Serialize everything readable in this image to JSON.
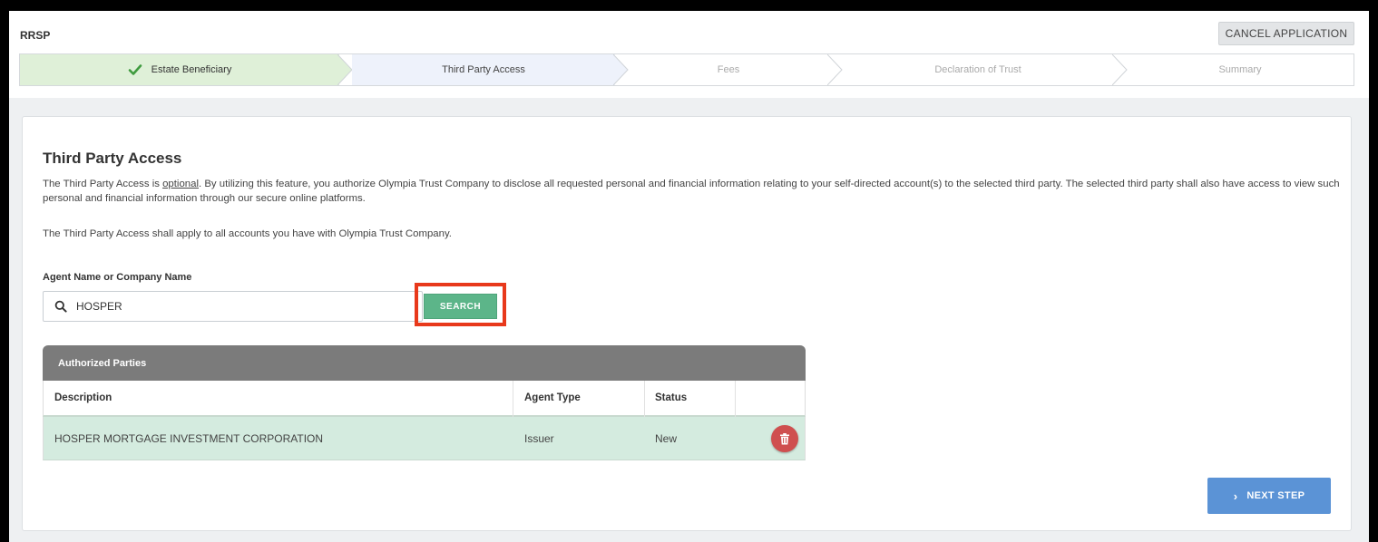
{
  "header": {
    "app_title": "RRSP",
    "cancel_label": "CANCEL APPLICATION"
  },
  "steps": [
    {
      "label": "Estate Beneficiary",
      "state": "done"
    },
    {
      "label": "Third Party Access",
      "state": "active"
    },
    {
      "label": "Fees",
      "state": "future"
    },
    {
      "label": "Declaration of Trust",
      "state": "future"
    },
    {
      "label": "Summary",
      "state": "future"
    }
  ],
  "section": {
    "title": "Third Party Access",
    "intro_pre": "The Third Party Access is ",
    "intro_link": "optional",
    "intro_post": ". By utilizing this feature, you authorize Olympia Trust Company to disclose all requested personal and financial information relating to your self-directed account(s) to the selected third party. The selected third party shall also have access to view such personal and financial information through our secure online platforms.",
    "apply_note": "The Third Party Access shall apply to all accounts you have with Olympia Trust Company."
  },
  "search": {
    "label": "Agent Name or Company Name",
    "value": "HOSPER",
    "button_label": "SEARCH",
    "icon": "search-icon"
  },
  "table": {
    "title": "Authorized Parties",
    "columns": [
      "Description",
      "Agent Type",
      "Status"
    ],
    "rows": [
      {
        "description": "HOSPER MORTGAGE INVESTMENT CORPORATION",
        "agent_type": "Issuer",
        "status": "New"
      }
    ]
  },
  "footer": {
    "next_label": "NEXT STEP"
  },
  "colors": {
    "accent_green": "#5cb589",
    "accent_blue": "#5b93d6",
    "delete_red": "#cf4f4f",
    "highlight": "#e8391b"
  }
}
